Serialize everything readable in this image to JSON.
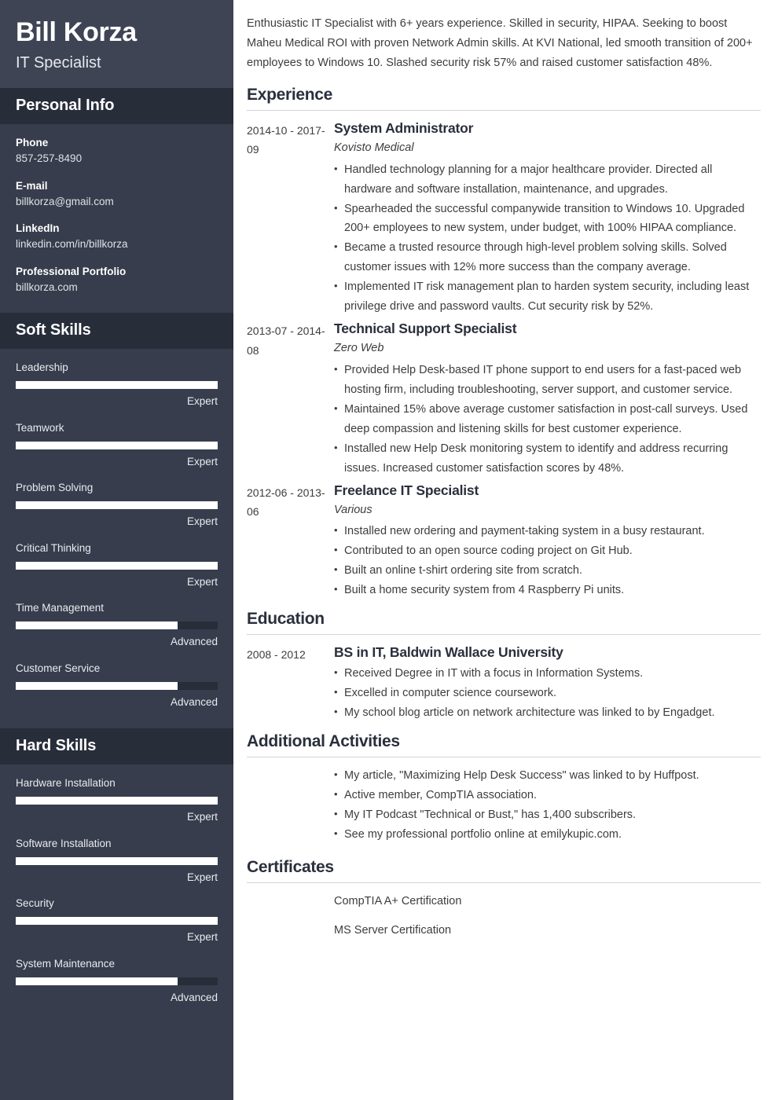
{
  "theme": {
    "sidebar_bg": "#373d4c",
    "sidebar_header_bg": "#3e4454",
    "sidebar_section_bg": "#282d3a",
    "bar_fill": "#ffffff",
    "bar_track": "#282d3a",
    "main_bg": "#ffffff",
    "heading_color": "#2a2f3c",
    "body_text_color": "#3d3d3d",
    "rule_color": "#d3d4d8"
  },
  "sidebar": {
    "name": "Bill Korza",
    "job_title": "IT Specialist",
    "personal_info": {
      "heading": "Personal Info",
      "items": [
        {
          "label": "Phone",
          "value": "857-257-8490"
        },
        {
          "label": "E-mail",
          "value": "billkorza@gmail.com"
        },
        {
          "label": "LinkedIn",
          "value": "linkedin.com/in/billkorza"
        },
        {
          "label": "Professional Portfolio",
          "value": "billkorza.com"
        }
      ]
    },
    "soft_skills": {
      "heading": "Soft Skills",
      "items": [
        {
          "name": "Leadership",
          "level": "Expert",
          "percent": 100
        },
        {
          "name": "Teamwork",
          "level": "Expert",
          "percent": 100
        },
        {
          "name": "Problem Solving",
          "level": "Expert",
          "percent": 100
        },
        {
          "name": "Critical Thinking",
          "level": "Expert",
          "percent": 100
        },
        {
          "name": "Time Management",
          "level": "Advanced",
          "percent": 80
        },
        {
          "name": "Customer Service",
          "level": "Advanced",
          "percent": 80
        }
      ]
    },
    "hard_skills": {
      "heading": "Hard Skills",
      "items": [
        {
          "name": "Hardware Installation",
          "level": "Expert",
          "percent": 100
        },
        {
          "name": "Software Installation",
          "level": "Expert",
          "percent": 100
        },
        {
          "name": "Security",
          "level": "Expert",
          "percent": 100
        },
        {
          "name": "System Maintenance",
          "level": "Advanced",
          "percent": 80
        }
      ]
    }
  },
  "main": {
    "summary": "Enthusiastic IT Specialist with 6+ years experience. Skilled in security, HIPAA. Seeking to boost Maheu Medical ROI with proven Network Admin skills. At KVI National, led smooth transition of 200+ employees to Windows 10. Slashed security risk 57% and raised customer satisfaction 48%.",
    "experience": {
      "heading": "Experience",
      "entries": [
        {
          "dates": "2014-10 - 2017-09",
          "title": "System Administrator",
          "org": "Kovisto Medical",
          "bullets": [
            "Handled technology planning for a major healthcare provider. Directed all hardware and software installation, maintenance, and upgrades.",
            "Spearheaded the successful companywide transition to Windows 10. Upgraded 200+ employees to new system, under budget, with 100% HIPAA compliance.",
            "Became a trusted resource through high-level problem solving skills. Solved customer issues with 12% more success than the company average.",
            "Implemented IT risk management plan to harden system security, including least privilege drive and password vaults. Cut security risk by 52%."
          ]
        },
        {
          "dates": "2013-07 - 2014-08",
          "title": "Technical Support Specialist",
          "org": "Zero Web",
          "bullets": [
            "Provided Help Desk-based IT phone support to end users for a fast-paced web hosting firm, including troubleshooting, server support, and customer service.",
            "Maintained 15% above average customer satisfaction in post-call surveys. Used deep compassion and listening skills for best customer experience.",
            "Installed new Help Desk monitoring system to identify and address recurring issues. Increased customer satisfaction scores by 48%."
          ]
        },
        {
          "dates": "2012-06 - 2013-06",
          "title": "Freelance IT Specialist",
          "org": "Various",
          "bullets": [
            "Installed new ordering and payment-taking system in a busy restaurant.",
            "Contributed to an open source coding project on Git Hub.",
            "Built an online t-shirt ordering site from scratch.",
            "Built a home security system from 4 Raspberry Pi units."
          ]
        }
      ]
    },
    "education": {
      "heading": "Education",
      "entries": [
        {
          "dates": "2008 - 2012",
          "title": "BS in IT, Baldwin Wallace University",
          "bullets": [
            "Received Degree in IT with a focus in Information Systems.",
            "Excelled in computer science coursework.",
            "My school blog article on network architecture was linked to by Engadget."
          ]
        }
      ]
    },
    "additional_activities": {
      "heading": "Additional Activities",
      "bullets": [
        "My article, \"Maximizing Help Desk Success\" was linked to by Huffpost.",
        "Active member, CompTIA association.",
        "My IT Podcast \"Technical or Bust,\" has 1,400 subscribers.",
        "See my professional portfolio online at emilykupic.com."
      ]
    },
    "certificates": {
      "heading": "Certificates",
      "items": [
        "CompTIA A+ Certification",
        "MS Server Certification"
      ]
    }
  }
}
